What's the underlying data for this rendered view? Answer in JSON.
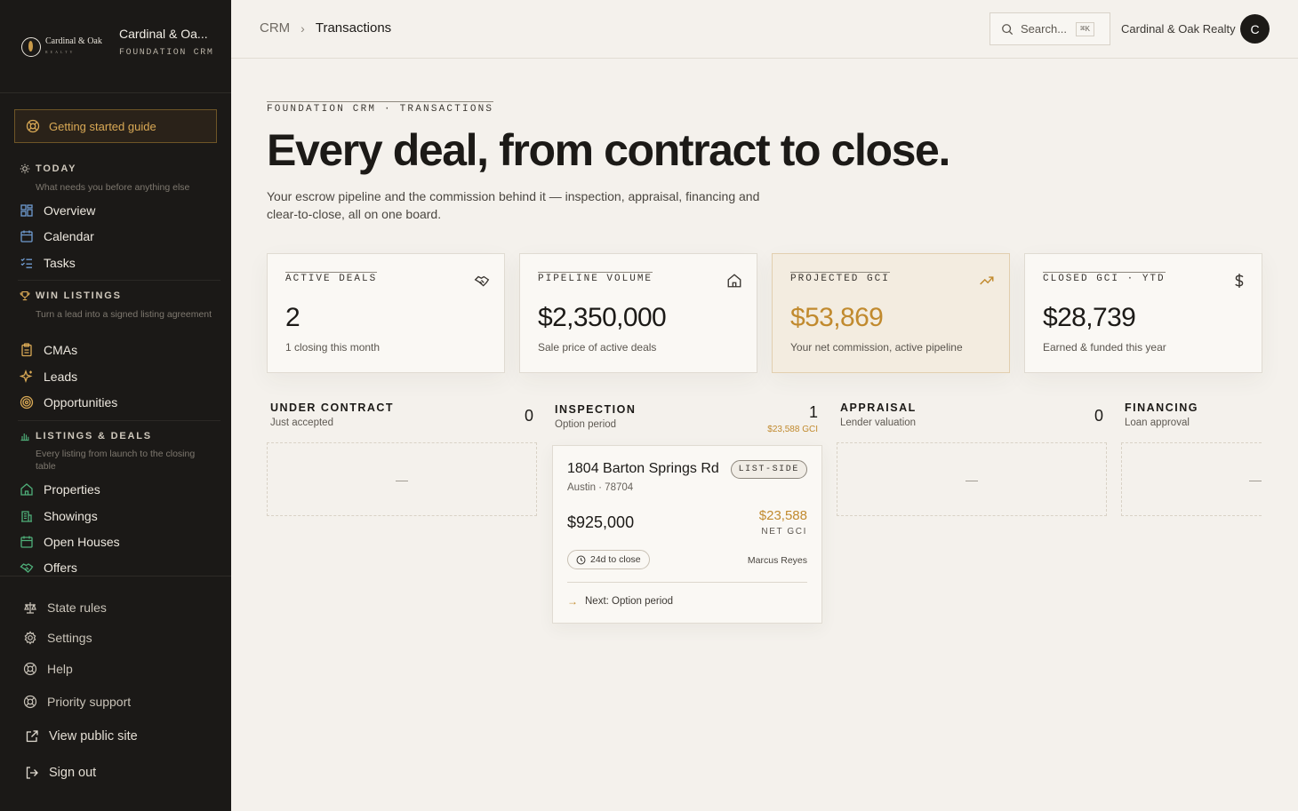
{
  "brand": {
    "logo_word": "Cardinal & Oak",
    "logo_sub": "REALTY",
    "name": "Cardinal & Oa...",
    "sub": "FOUNDATION CRM"
  },
  "sidebar": {
    "guide_label": "Getting started guide",
    "sections": [
      {
        "title": "TODAY",
        "icon": "sun-icon",
        "desc": "What needs you before anything else",
        "items": [
          {
            "label": "Overview",
            "icon": "grid-icon"
          },
          {
            "label": "Calendar",
            "icon": "calendar-icon"
          },
          {
            "label": "Tasks",
            "icon": "checklist-icon"
          }
        ]
      },
      {
        "title": "WIN LISTINGS",
        "icon": "trophy-icon",
        "desc": "Turn a lead into a signed listing agreement",
        "items": [
          {
            "label": "CMAs",
            "icon": "clipboard-icon"
          },
          {
            "label": "Leads",
            "icon": "sparkle-icon"
          },
          {
            "label": "Opportunities",
            "icon": "target-icon"
          }
        ]
      },
      {
        "title": "LISTINGS & DEALS",
        "icon": "bar-chart-icon",
        "desc": "Every listing from launch to the closing table",
        "items": [
          {
            "label": "Properties",
            "icon": "home-icon"
          },
          {
            "label": "Showings",
            "icon": "building-icon"
          },
          {
            "label": "Open Houses",
            "icon": "calendar-icon"
          },
          {
            "label": "Offers",
            "icon": "handshake-icon"
          }
        ]
      }
    ],
    "bottom": [
      {
        "label": "State rules",
        "icon": "scale-icon"
      },
      {
        "label": "Settings",
        "icon": "gear-icon"
      },
      {
        "label": "Help",
        "icon": "lifebuoy-icon"
      },
      {
        "label": "Priority support",
        "icon": "lifebuoy-icon"
      },
      {
        "label": "View public site",
        "icon": "external-link-icon"
      },
      {
        "label": "Sign out",
        "icon": "sign-out-icon"
      }
    ]
  },
  "header": {
    "breadcrumb": [
      "CRM",
      "Transactions"
    ],
    "search_placeholder": "Search...",
    "search_shortcut": "⌘K",
    "org_name": "Cardinal & Oak Realty",
    "avatar_initial": "C"
  },
  "page": {
    "eyebrow": "FOUNDATION CRM · TRANSACTIONS",
    "title": "Every deal, from contract to close.",
    "intro": "Your escrow pipeline and the commission behind it — inspection, appraisal, financing and clear-to-close, all on one board."
  },
  "stats": [
    {
      "label": "ACTIVE DEALS",
      "value": "2",
      "sub": "1 closing this month",
      "icon": "handshake-icon"
    },
    {
      "label": "PIPELINE VOLUME",
      "value": "$2,350,000",
      "sub": "Sale price of active deals",
      "icon": "home-icon"
    },
    {
      "label": "PROJECTED GCI",
      "value": "$53,869",
      "sub": "Your net commission, active pipeline",
      "icon": "trending-up-icon"
    },
    {
      "label": "CLOSED GCI · YTD",
      "value": "$28,739",
      "sub": "Earned & funded this year",
      "icon": "dollar-icon"
    }
  ],
  "columns": [
    {
      "title": "UNDER CONTRACT",
      "sub": "Just accepted",
      "count": "0",
      "gci": "",
      "empty": "—"
    },
    {
      "title": "INSPECTION",
      "sub": "Option period",
      "count": "1",
      "gci": "$23,588 GCI",
      "empty": ""
    },
    {
      "title": "APPRAISAL",
      "sub": "Lender valuation",
      "count": "0",
      "gci": "",
      "empty": "—"
    },
    {
      "title": "FINANCING",
      "sub": "Loan approval",
      "count": "",
      "gci": "",
      "empty": "—"
    }
  ],
  "deal_card": {
    "address": "1804 Barton Springs Rd",
    "city": "Austin · 78704",
    "badge": "LIST-SIDE",
    "price": "$925,000",
    "gci": "$23,588",
    "gci_label": "NET GCI",
    "days": "24d to close",
    "agent": "Marcus Reyes",
    "next": "Next: Option period"
  }
}
